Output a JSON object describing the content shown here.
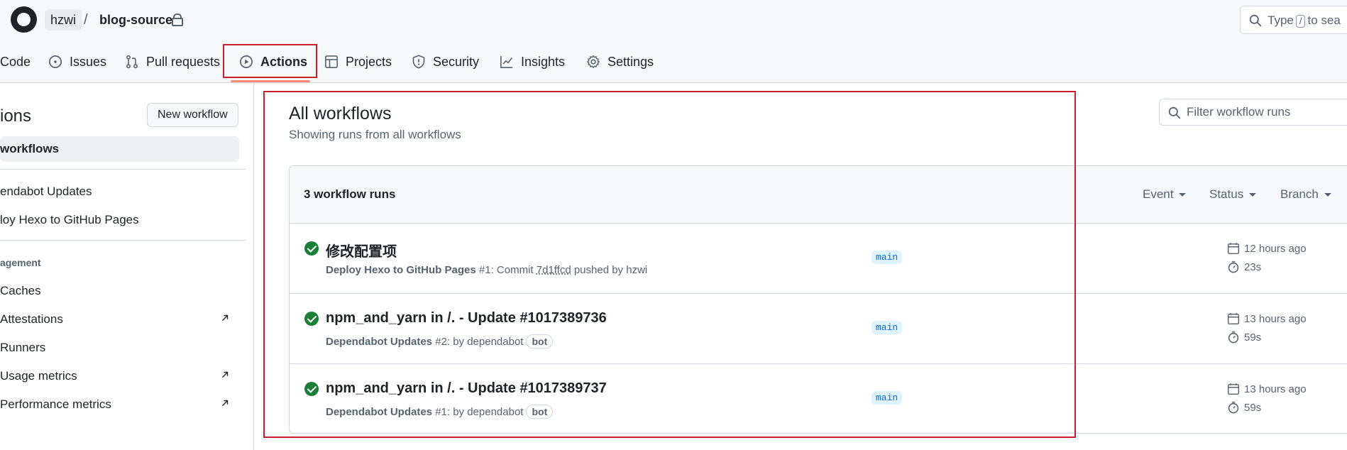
{
  "header": {
    "owner": "hzwi",
    "separator": "/",
    "repo": "blog-source",
    "search": {
      "prefix": "Type",
      "key": "/",
      "suffix": "to sea"
    }
  },
  "tabs": [
    {
      "label": "Code",
      "icon": "code-icon"
    },
    {
      "label": "Issues",
      "icon": "issue-opened-icon"
    },
    {
      "label": "Pull requests",
      "icon": "git-pull-request-icon"
    },
    {
      "label": "Actions",
      "icon": "play-icon",
      "selected": true
    },
    {
      "label": "Projects",
      "icon": "table-icon"
    },
    {
      "label": "Security",
      "icon": "shield-icon"
    },
    {
      "label": "Insights",
      "icon": "graph-icon"
    },
    {
      "label": "Settings",
      "icon": "gear-icon"
    }
  ],
  "sidebar": {
    "title": "ions",
    "new_workflow": "New workflow",
    "all_workflows": "workflows",
    "workflows": [
      "endabot Updates",
      "loy Hexo to GitHub Pages"
    ],
    "management_heading": "agement",
    "management": [
      {
        "label": "Caches",
        "external": false
      },
      {
        "label": "Attestations",
        "external": true
      },
      {
        "label": "Runners",
        "external": false
      },
      {
        "label": "Usage metrics",
        "external": true
      },
      {
        "label": "Performance metrics",
        "external": true
      }
    ]
  },
  "main": {
    "title": "All workflows",
    "subtitle": "Showing runs from all workflows",
    "filter_placeholder": "Filter workflow runs",
    "runs_count": "3 workflow runs",
    "filters": {
      "event": "Event",
      "status": "Status",
      "branch": "Branch"
    },
    "runs": [
      {
        "title": "修改配置项",
        "workflow": "Deploy Hexo to GitHub Pages",
        "number": "#1",
        "meta_pre": ": Commit ",
        "sha": "7d1ffcd",
        "meta_post": " pushed by hzwi",
        "branch": "main",
        "when": "12 hours ago",
        "duration": "23s",
        "status": "success"
      },
      {
        "title": "npm_and_yarn in /. - Update #1017389736",
        "workflow": "Dependabot Updates",
        "number": "#2",
        "meta_pre": ": by dependabot",
        "badge": "bot",
        "branch": "main",
        "when": "13 hours ago",
        "duration": "59s",
        "status": "success"
      },
      {
        "title": "npm_and_yarn in /. - Update #1017389737",
        "workflow": "Dependabot Updates",
        "number": "#1",
        "meta_pre": ": by dependabot",
        "badge": "bot",
        "branch": "main",
        "when": "13 hours ago",
        "duration": "59s",
        "status": "success"
      }
    ]
  },
  "colors": {
    "success": "#1a7f37",
    "highlight": "#c8202c",
    "tab_underline": "#fd8c73",
    "branch_bg": "#ddf4ff",
    "branch_fg": "#0969da"
  }
}
